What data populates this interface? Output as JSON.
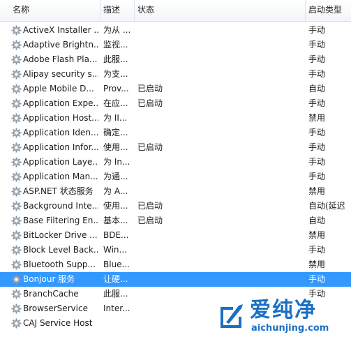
{
  "columns": {
    "name": "名称",
    "desc": "描述",
    "status": "状态",
    "startup": "启动类型"
  },
  "rows": [
    {
      "name": "ActiveX Installer ...",
      "desc": "为从 ...",
      "status": "",
      "startup": "手动"
    },
    {
      "name": "Adaptive Brightn...",
      "desc": "监视...",
      "status": "",
      "startup": "手动"
    },
    {
      "name": "Adobe Flash Pla...",
      "desc": "此服...",
      "status": "",
      "startup": "手动"
    },
    {
      "name": "Alipay security s...",
      "desc": "为支...",
      "status": "",
      "startup": "手动"
    },
    {
      "name": "Apple Mobile D...",
      "desc": "Prov...",
      "status": "已启动",
      "startup": "自动"
    },
    {
      "name": "Application Expe...",
      "desc": "在应...",
      "status": "已启动",
      "startup": "手动"
    },
    {
      "name": "Application Host...",
      "desc": "为 II...",
      "status": "",
      "startup": "禁用"
    },
    {
      "name": "Application Iden...",
      "desc": "确定...",
      "status": "",
      "startup": "手动"
    },
    {
      "name": "Application Infor...",
      "desc": "使用...",
      "status": "已启动",
      "startup": "手动"
    },
    {
      "name": "Application Laye...",
      "desc": "为 In...",
      "status": "",
      "startup": "手动"
    },
    {
      "name": "Application Man...",
      "desc": "为通...",
      "status": "",
      "startup": "手动"
    },
    {
      "name": "ASP.NET 状态服务",
      "desc": "为 A...",
      "status": "",
      "startup": "禁用"
    },
    {
      "name": "Background Inte...",
      "desc": "使用...",
      "status": "已启动",
      "startup": "自动(延迟"
    },
    {
      "name": "Base Filtering En...",
      "desc": "基本...",
      "status": "已启动",
      "startup": "自动"
    },
    {
      "name": "BitLocker Drive ...",
      "desc": "BDE...",
      "status": "",
      "startup": "禁用"
    },
    {
      "name": "Block Level Back...",
      "desc": "Win...",
      "status": "",
      "startup": "手动"
    },
    {
      "name": "Bluetooth Supp...",
      "desc": "Blue...",
      "status": "",
      "startup": "禁用"
    },
    {
      "name": "Bonjour 服务",
      "desc": "让硬...",
      "status": "",
      "startup": "手动",
      "selected": true
    },
    {
      "name": "BranchCache",
      "desc": "此服...",
      "status": "",
      "startup": "手动"
    },
    {
      "name": "BrowserService",
      "desc": "Inter...",
      "status": "",
      "startup": ""
    },
    {
      "name": "CAJ Service Host",
      "desc": "",
      "status": "",
      "startup": ""
    }
  ],
  "watermark": {
    "brand": "爱纯净",
    "url": "aichunjing.com"
  },
  "colors": {
    "selection": "#3399ff",
    "brand": "#1a6fc4"
  },
  "icons": {
    "service": "gear-icon",
    "logo": "aichunjing-logo-icon"
  }
}
